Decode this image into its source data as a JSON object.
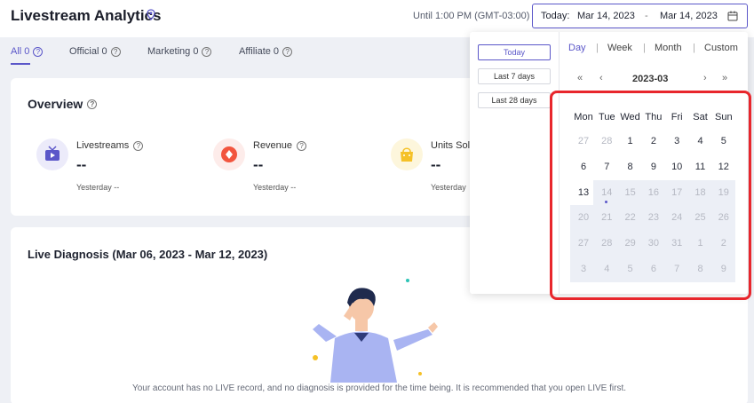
{
  "header": {
    "title": "Livestream Analytics",
    "until": "Until 1:00 PM (GMT-03:00)",
    "date_label": "Today:",
    "date_start": "Mar 14, 2023",
    "date_sep": "-",
    "date_end": "Mar 14, 2023"
  },
  "tabs": [
    {
      "label": "All 0",
      "active": true
    },
    {
      "label": "Official 0",
      "active": false
    },
    {
      "label": "Marketing 0",
      "active": false
    },
    {
      "label": "Affiliate 0",
      "active": false
    }
  ],
  "overview": {
    "title": "Overview",
    "metrics": [
      {
        "label": "Livestreams",
        "value": "--",
        "sub": "Yesterday --",
        "icon": "livestream-icon",
        "color": "#5b57c9"
      },
      {
        "label": "Revenue",
        "value": "--",
        "sub": "Yesterday --",
        "icon": "revenue-icon",
        "color": "#f2553e"
      },
      {
        "label": "Units Sol",
        "value": "--",
        "sub": "Yesterday",
        "icon": "shopping-bag-icon",
        "color": "#f5c127"
      }
    ]
  },
  "diagnosis": {
    "title": "Live Diagnosis (Mar 06, 2023 - Mar 12, 2023)",
    "empty_message": "Your account has no LIVE record, and no diagnosis is provided for the time being. It is recommended that you open LIVE first."
  },
  "picker": {
    "presets": [
      "Today",
      "Last 7 days",
      "Last 28 days"
    ],
    "active_preset": "Today",
    "modes": [
      "Day",
      "Week",
      "Month",
      "Custom"
    ],
    "active_mode": "Day",
    "month_label": "2023-03",
    "nav": {
      "prev_year": "«",
      "prev_month": "‹",
      "next_month": "›",
      "next_year": "»"
    },
    "weekdays": [
      "Mon",
      "Tue",
      "Wed",
      "Thu",
      "Fri",
      "Sat",
      "Sun"
    ],
    "weeks": [
      [
        "27",
        "28",
        "1",
        "2",
        "3",
        "4",
        "5"
      ],
      [
        "6",
        "7",
        "8",
        "9",
        "10",
        "11",
        "12"
      ],
      [
        "13",
        "14",
        "15",
        "16",
        "17",
        "18",
        "19"
      ],
      [
        "20",
        "21",
        "22",
        "23",
        "24",
        "25",
        "26"
      ],
      [
        "27",
        "28",
        "29",
        "30",
        "31",
        "1",
        "2"
      ],
      [
        "3",
        "4",
        "5",
        "6",
        "7",
        "8",
        "9"
      ]
    ],
    "today": "14"
  },
  "colors": {
    "accent": "#5b57c9",
    "highlight": "#e8262c"
  }
}
